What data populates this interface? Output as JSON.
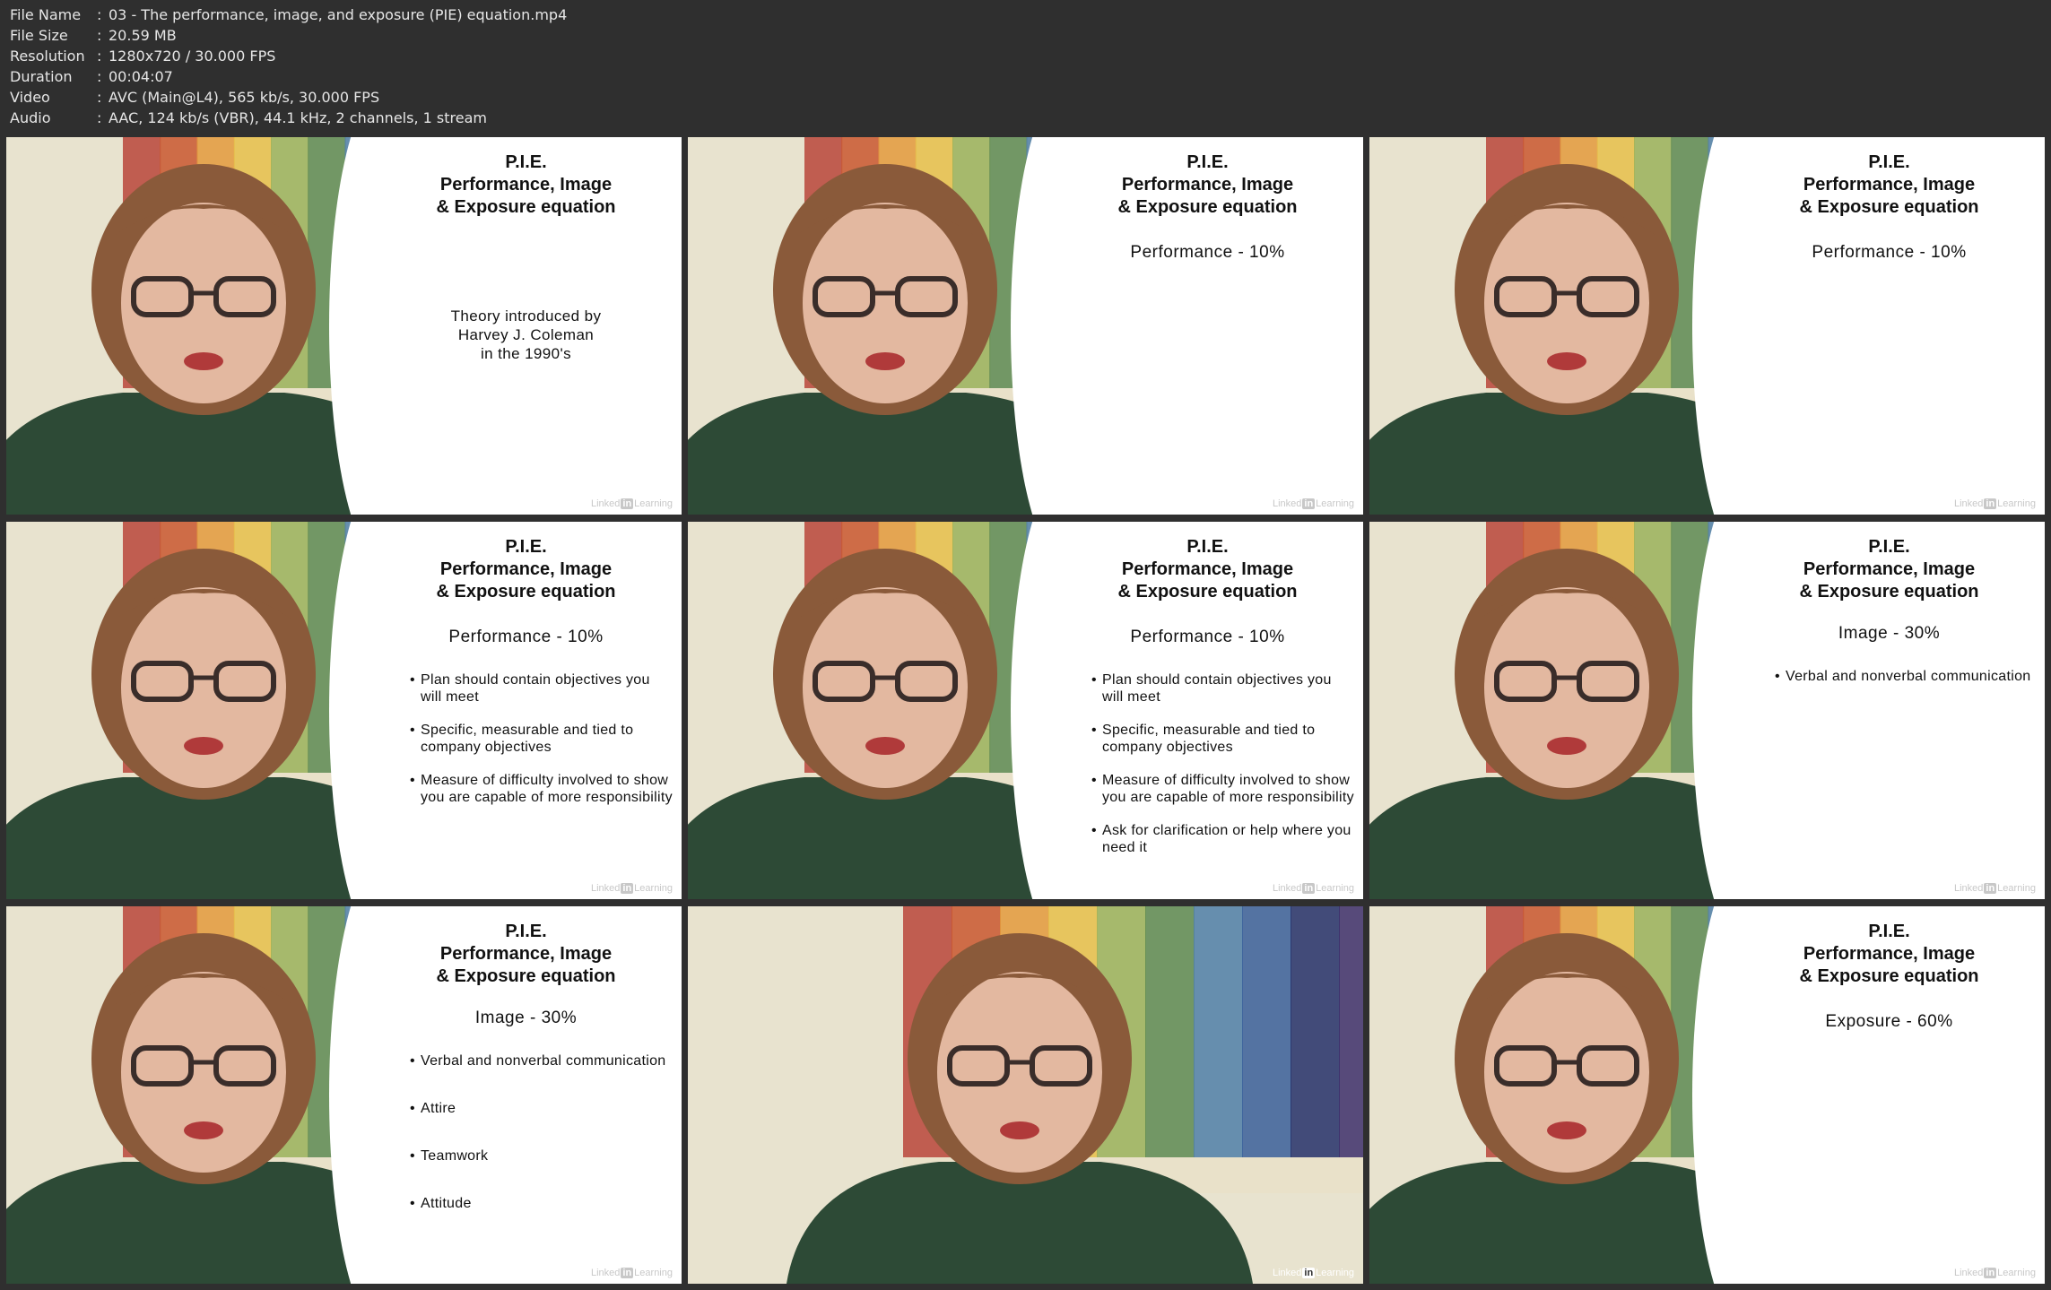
{
  "file_info": {
    "rows": [
      {
        "label": "File Name",
        "value": "03 - The performance, image, and exposure (PIE) equation.mp4"
      },
      {
        "label": "File Size",
        "value": "20.59 MB"
      },
      {
        "label": "Resolution",
        "value": "1280x720 / 30.000 FPS"
      },
      {
        "label": "Duration",
        "value": "00:04:07"
      },
      {
        "label": "Video",
        "value": "AVC (Main@L4), 565 kb/s, 30.000 FPS"
      },
      {
        "label": "Audio",
        "value": "AAC, 124 kb/s (VBR), 44.1 kHz, 2 channels, 1 stream"
      }
    ]
  },
  "slide": {
    "title_line1": "P.I.E.",
    "title_line2": "Performance, Image",
    "title_line3": "& Exposure equation"
  },
  "watermark": {
    "before": "Linked",
    "box": "in",
    "after": "Learning"
  },
  "frames": [
    {
      "theory": [
        "Theory introduced by",
        "Harvey J. Coleman",
        "in the 1990's"
      ]
    },
    {
      "subtitle": "Performance - 10%"
    },
    {
      "subtitle": "Performance - 10%"
    },
    {
      "subtitle": "Performance - 10%",
      "bullets": [
        "Plan should contain objectives you will meet",
        "Specific, measurable and tied to company objectives",
        "Measure of difficulty involved to show you are capable of more responsibility"
      ]
    },
    {
      "subtitle": "Performance - 10%",
      "bullets": [
        "Plan should contain objectives you will meet",
        "Specific, measurable and tied to company objectives",
        "Measure of difficulty involved to show you are capable of more responsibility",
        "Ask for clarification or help where you need it"
      ]
    },
    {
      "subtitle": "Image - 30%",
      "bullets": [
        "Verbal and nonverbal communication"
      ]
    },
    {
      "subtitle": "Image - 30%",
      "bullets": [
        "Verbal and nonverbal communication",
        "Attire",
        "Teamwork",
        "Attitude"
      ]
    },
    {},
    {
      "subtitle": "Exposure - 60%"
    }
  ],
  "colors": {
    "background": "#2f2f2f",
    "header_text": "#e6e6e6",
    "slide_panel": "#ffffff",
    "sweater": "#2d4a36",
    "hair": "#8a5a3a",
    "skin": "#e3b8a0",
    "wall": "#e8e3cf"
  }
}
